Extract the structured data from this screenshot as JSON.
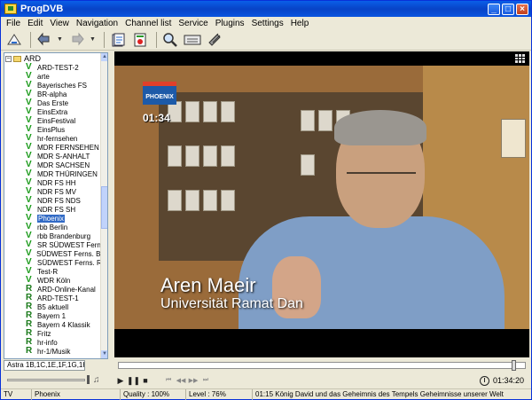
{
  "window": {
    "title": "ProgDVB",
    "minimize": "_",
    "maximize": "□",
    "close": "×"
  },
  "menu": [
    "File",
    "Edit",
    "View",
    "Navigation",
    "Channel list",
    "Service",
    "Plugins",
    "Settings",
    "Help"
  ],
  "toolbar": {
    "icons": [
      "scan-icon",
      "back-icon",
      "forward-icon",
      "channel-list-icon",
      "record-icon",
      "zoom-icon",
      "teletext-icon",
      "satellite-icon"
    ]
  },
  "channel_tree": {
    "root_label": "ARD",
    "expander": "−",
    "channels": [
      {
        "type": "V",
        "name": "ARD-TEST-2"
      },
      {
        "type": "V",
        "name": "arte"
      },
      {
        "type": "V",
        "name": "Bayerisches FS"
      },
      {
        "type": "V",
        "name": "BR-alpha"
      },
      {
        "type": "V",
        "name": "Das Erste"
      },
      {
        "type": "V",
        "name": "EinsExtra"
      },
      {
        "type": "V",
        "name": "EinsFestival"
      },
      {
        "type": "V",
        "name": "EinsPlus"
      },
      {
        "type": "V",
        "name": "hr-fernsehen"
      },
      {
        "type": "V",
        "name": "MDR FERNSEHEN"
      },
      {
        "type": "V",
        "name": "MDR S-ANHALT"
      },
      {
        "type": "V",
        "name": "MDR SACHSEN"
      },
      {
        "type": "V",
        "name": "MDR THÜRINGEN"
      },
      {
        "type": "V",
        "name": "NDR FS HH"
      },
      {
        "type": "V",
        "name": "NDR FS MV"
      },
      {
        "type": "V",
        "name": "NDR FS NDS"
      },
      {
        "type": "V",
        "name": "NDR FS SH"
      },
      {
        "type": "V",
        "name": "Phoenix",
        "selected": true
      },
      {
        "type": "V",
        "name": "rbb Berlin"
      },
      {
        "type": "V",
        "name": "rbb Brandenburg"
      },
      {
        "type": "V",
        "name": "SR SÜDWEST Ferns."
      },
      {
        "type": "V",
        "name": "SÜDWEST Ferns. BW"
      },
      {
        "type": "V",
        "name": "SÜDWEST Ferns. RP"
      },
      {
        "type": "V",
        "name": "Test-R"
      },
      {
        "type": "V",
        "name": "WDR Köln"
      },
      {
        "type": "R",
        "name": "ARD-Online-Kanal"
      },
      {
        "type": "R",
        "name": "ARD-TEST-1"
      },
      {
        "type": "R",
        "name": "B5 aktuell"
      },
      {
        "type": "R",
        "name": "Bayern 1"
      },
      {
        "type": "R",
        "name": "Bayern 4 Klassik"
      },
      {
        "type": "R",
        "name": "Fritz"
      },
      {
        "type": "R",
        "name": "hr-info"
      },
      {
        "type": "R",
        "name": "hr-1/Musik"
      }
    ],
    "satellite_tab": "Astra 1B,1C,1E,1F,1G,1H,2C"
  },
  "video": {
    "channel_logo": "PHOENIX",
    "osd_time": "01:34",
    "caption_name": "Aren Maeir",
    "caption_sub": "Universität Ramat Dan"
  },
  "player": {
    "seek_position": 0.98,
    "time_display": "01:34:20"
  },
  "status": {
    "mode": "TV",
    "channel": "Phoenix",
    "quality": "Quality : 100%",
    "level": "Level : 76%",
    "epg": "01:15  König David und das Geheimnis des Tempels  Geheimnisse unserer Welt"
  }
}
